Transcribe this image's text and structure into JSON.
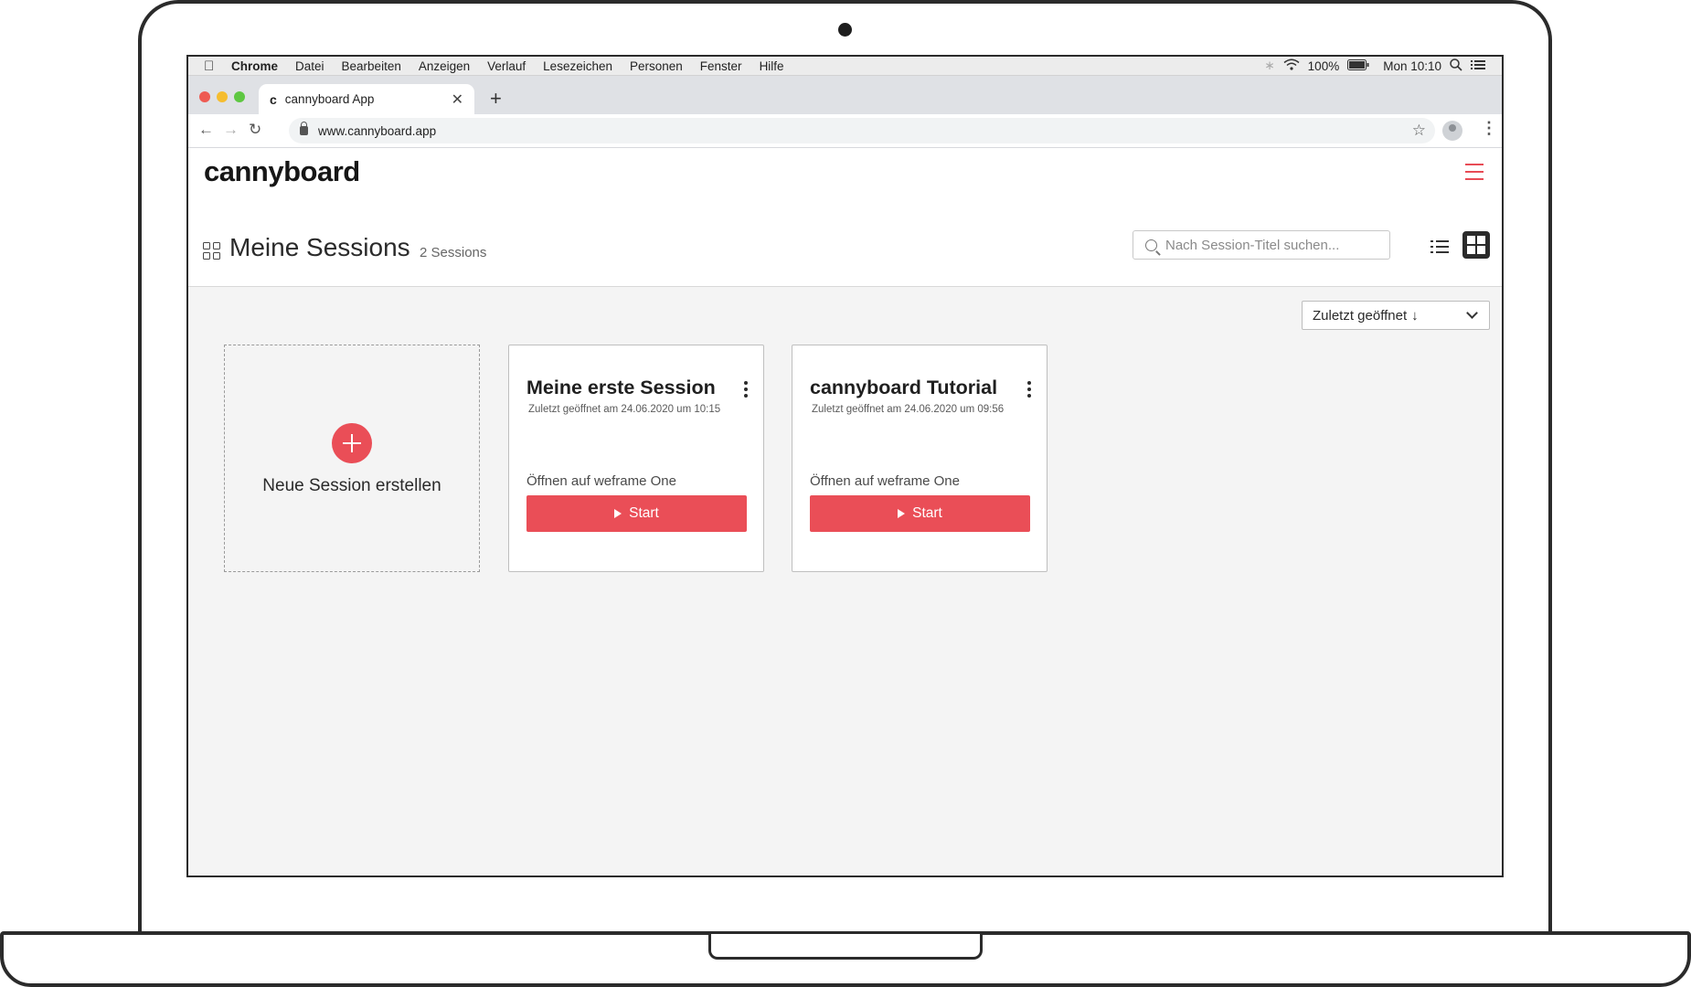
{
  "menubar": {
    "apple_icon": "apple-icon",
    "items": [
      "Chrome",
      "Datei",
      "Bearbeiten",
      "Anzeigen",
      "Verlauf",
      "Lesezeichen",
      "Personen",
      "Fenster",
      "Hilfe"
    ],
    "battery": "100%",
    "clock": "Mon 10:10"
  },
  "browser": {
    "tab_title": "cannyboard App",
    "favicon": "c",
    "url": "www.cannyboard.app",
    "traffic_colors": [
      "#ee5b53",
      "#f5bd30",
      "#5ec742"
    ]
  },
  "app": {
    "logo": "cannyboard",
    "accent": "#ea4e57"
  },
  "page": {
    "title": "Meine Sessions",
    "count": "2 Sessions",
    "search_placeholder": "Nach Session-Titel suchen...",
    "sort_label": "Zuletzt geöffnet",
    "sort_arrow": "↓"
  },
  "new_session": {
    "label": "Neue Session erstellen"
  },
  "sessions": [
    {
      "title": "Meine erste Session",
      "last_opened": "Zuletzt geöffnet am 24.06.2020 um 10:15",
      "open_on": "Öffnen auf weframe One",
      "start": "Start"
    },
    {
      "title": "cannyboard Tutorial",
      "last_opened": "Zuletzt geöffnet am 24.06.2020 um 09:56",
      "open_on": "Öffnen auf weframe One",
      "start": "Start"
    }
  ]
}
